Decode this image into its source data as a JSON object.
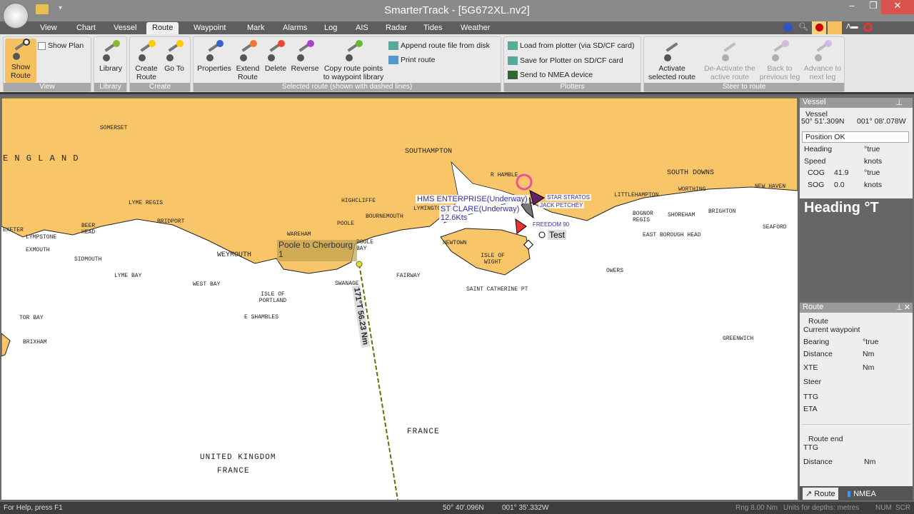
{
  "window": {
    "title": "SmarterTrack - [5G672XL.nv2]",
    "minimize": "–",
    "restore": "❐",
    "close": "✕"
  },
  "tabs": [
    "View",
    "Chart",
    "Vessel",
    "Route",
    "Waypoint",
    "Mark",
    "Alarms",
    "Log",
    "AIS",
    "Radar",
    "Tides",
    "Weather"
  ],
  "active_tab": "Route",
  "ribbon": {
    "view": {
      "label": "View",
      "show_route": "Show Route",
      "show_plan": "Show Plan",
      "show_plan_checked": false
    },
    "library": {
      "label": "Library",
      "library": "Library"
    },
    "create": {
      "label": "Create",
      "create_route": "Create Route",
      "go_to": "Go To"
    },
    "selected": {
      "label": "Selected route (shown with dashed lines)",
      "properties": "Properties",
      "extend": "Extend Route",
      "delete": "Delete",
      "reverse": "Reverse",
      "copy": "Copy route points to waypoint library",
      "append": "Append route file from disk",
      "print": "Print route"
    },
    "plotters": {
      "label": "Plotters",
      "load": "Load from plotter (via SD/CF card)",
      "save": "Save for Plotter on SD/CF card",
      "send": "Send to NMEA device"
    },
    "steer": {
      "label": "Steer to route",
      "activate": "Activate selected route",
      "deactivate": "De-Activate the active route",
      "back": "Back to previous leg",
      "advance": "Advance to next leg"
    }
  },
  "map": {
    "labels": {
      "england": "E N G L A N D",
      "somerset": "SOMERSET",
      "southampton": "SOUTHAMPTON",
      "south_downs": "SOUTH DOWNS",
      "r_hamble": "R HAMBLE",
      "lyme_regis": "LYME REGIS",
      "highcliffe": "HIGHCLIFFE",
      "bournemouth": "BOURNEMOUTH",
      "lymington": "LYMINGTON",
      "poole": "POOLE",
      "poole_bay": "POOLE BAY",
      "wareham": "WAREHAM",
      "weymouth": "WEYMOUTH",
      "bridport": "BRIDPORT",
      "beer_head": "BEER HEAD",
      "lympstone": "LYMPSTONE",
      "exeter": "EXETER",
      "exmouth": "EXMOUTH",
      "sidmouth": "SIDMOUTH",
      "lyme_bay": "LYME BAY",
      "west_bay": "WEST BAY",
      "isle_of_portland": "ISLE OF PORTLAND",
      "e_shambles": "E SHAMBLES",
      "tor_bay": "TOR BAY",
      "brixham": "BRIXHAM",
      "swanage": "SWANAGE",
      "fairway": "FAIRWAY",
      "newtown": "NEWTOWN",
      "isle_of_wight": "ISLE OF WIGHT",
      "saint_catherine": "SAINT CATHERINE PT",
      "littlehampton": "LITTLEHAMPTON",
      "worthing": "WORTHING",
      "new_haven": "NEW HAVEN",
      "bognor": "BOGNOR REGIS",
      "shoreham": "SHOREHAM",
      "brighton": "BRIGHTON",
      "east_borough": "EAST BOROUGH HEAD",
      "seaford": "SEAFORD",
      "owers": "OWERS",
      "greenwich": "GREENWICH",
      "france1": "FRANCE",
      "uk": "UNITED KINGDOM",
      "france2": "FRANCE"
    },
    "route_name": "Poole to Cherbourg\n1",
    "route_leg": "171°T 56.23 Nm",
    "ais": [
      "HMS ENTERPRISE(Underway)",
      "ST CLARE(Underway)",
      "12.6Kts",
      "STAR STRATOS",
      "JACK PETCHEY",
      "FREEDOM 90"
    ],
    "mark": "Test",
    "colors": {
      "land": "#f8c568",
      "sea": "#ffffff",
      "route": "#6b6b10"
    }
  },
  "vessel_panel": {
    "title": "Vessel",
    "group": "Vessel",
    "lat": "50° 51'.309N",
    "lon": "001° 08'.078W",
    "status": "Position OK",
    "heading": "Heading",
    "heading_unit": "°true",
    "speed": "Speed",
    "speed_unit": "knots",
    "cog": "COG",
    "cog_val": "41.9",
    "cog_unit": "°true",
    "sog": "SOG",
    "sog_val": "0.0",
    "sog_unit": "knots"
  },
  "heading_display": "Heading °T",
  "route_panel": {
    "title": "Route",
    "group": "Route",
    "current": "Current waypoint",
    "bearing": "Bearing",
    "bearing_unit": "°true",
    "distance": "Distance",
    "distance_unit": "Nm",
    "xte": "XTE",
    "xte_unit": "Nm",
    "steer": "Steer",
    "ttg": "TTG",
    "eta": "ETA",
    "end_group": "Route end",
    "end_ttg": "TTG",
    "end_distance": "Distance",
    "end_distance_unit": "Nm"
  },
  "bottom_tabs": [
    "Route",
    "NMEA"
  ],
  "status": {
    "help": "For Help, press F1",
    "lat": "50° 40'.096N",
    "lon": "001° 35'.332W",
    "range": "Rng 8.00 Nm",
    "units": "Units for depths: metres",
    "num": "NUM",
    "scr": "SCR"
  }
}
